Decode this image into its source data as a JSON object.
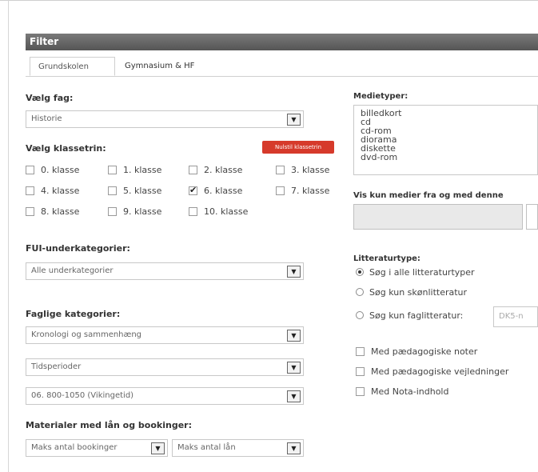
{
  "filter": {
    "title": "Filter",
    "tabs": [
      {
        "label": "Grundskolen",
        "active": true
      },
      {
        "label": "Gymnasium & HF",
        "active": false
      }
    ]
  },
  "subject": {
    "label": "Vælg fag:",
    "selected": "Historie"
  },
  "grades": {
    "label": "Vælg klassetrin:",
    "reset_label": "Nulstil klassetrin",
    "items": [
      {
        "label": "0. klasse",
        "checked": false
      },
      {
        "label": "1. klasse",
        "checked": false
      },
      {
        "label": "2. klasse",
        "checked": false
      },
      {
        "label": "3. klasse",
        "checked": false
      },
      {
        "label": "4. klasse",
        "checked": false
      },
      {
        "label": "5. klasse",
        "checked": false
      },
      {
        "label": "6. klasse",
        "checked": true
      },
      {
        "label": "7. klasse",
        "checked": false
      },
      {
        "label": "8. klasse",
        "checked": false
      },
      {
        "label": "9. klasse",
        "checked": false
      },
      {
        "label": "10. klasse",
        "checked": false
      }
    ]
  },
  "fui": {
    "label": "FUI-underkategorier:",
    "selected": "Alle underkategorier"
  },
  "categories": {
    "label": "Faglige kategorier:",
    "selects": [
      "Kronologi og sammenhæng",
      "Tidsperioder",
      "06. 800-1050 (Vikingetid)"
    ]
  },
  "materials": {
    "label": "Materialer med lån og bookinger:",
    "bookings": "Maks antal bookinger",
    "loans": "Maks antal lån"
  },
  "media": {
    "label": "Medietyper:",
    "options": [
      "billedkort",
      "cd",
      "cd-rom",
      "diorama",
      "diskette",
      "dvd-rom"
    ]
  },
  "from_date": {
    "label": "Vis kun medier fra og med denne"
  },
  "lit": {
    "label": "Litteraturtype:",
    "options": [
      {
        "label": "Søg i alle litteraturtyper",
        "selected": true
      },
      {
        "label": "Søg kun skønlitteratur",
        "selected": false
      },
      {
        "label": "Søg kun faglitteratur:",
        "selected": false
      }
    ],
    "dk5_placeholder": "DK5-n"
  },
  "extras": [
    {
      "label": "Med pædagogiske noter",
      "checked": false
    },
    {
      "label": "Med pædagogiske vejledninger",
      "checked": false
    },
    {
      "label": "Med Nota-indhold",
      "checked": false
    }
  ]
}
